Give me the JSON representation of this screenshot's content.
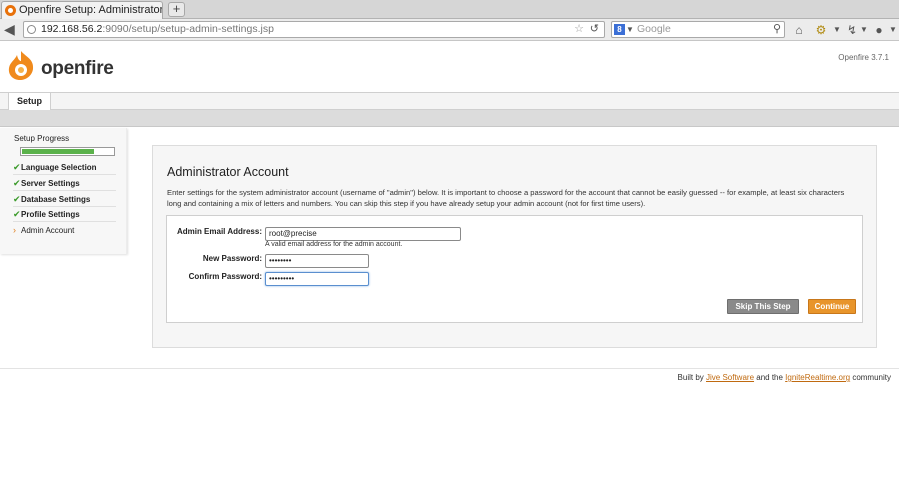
{
  "browser": {
    "tab_title": "Openfire Setup: Administrator Acc...",
    "new_tab_label": "+",
    "url_host": "192.168.56.2",
    "url_rest": ":9090/setup/setup-admin-settings.jsp",
    "search_placeholder": "Google"
  },
  "header": {
    "logo_text": "openfire",
    "version": "Openfire 3.7.1"
  },
  "nav": {
    "setup_tab": "Setup"
  },
  "sidebar": {
    "title": "Setup Progress",
    "progress_fraction": 0.8,
    "items": [
      {
        "label": "Language Selection",
        "done": true
      },
      {
        "label": "Server Settings",
        "done": true
      },
      {
        "label": "Database Settings",
        "done": true
      },
      {
        "label": "Profile Settings",
        "done": true
      },
      {
        "label": "Admin Account",
        "done": false
      }
    ]
  },
  "main": {
    "title": "Administrator Account",
    "description": "Enter settings for the system administrator account (username of \"admin\") below. It is important to choose a password for the account that cannot be easily guessed -- for example, at least six characters long and containing a mix of letters and numbers. You can skip this step if you have already setup your admin account (not for first time users).",
    "email_label": "Admin Email Address:",
    "email_value": "root@precise",
    "email_hint": "A valid email address for the admin account.",
    "new_password_label": "New Password:",
    "new_password_value": "••••••••",
    "confirm_password_label": "Confirm Password:",
    "confirm_password_value": "•••••••••",
    "skip_button": "Skip This Step",
    "continue_button": "Continue"
  },
  "footer": {
    "prefix": "Built by ",
    "link1": "Jive Software",
    "middle": " and the ",
    "link2": "IgniteRealtime.org",
    "suffix": " community"
  }
}
